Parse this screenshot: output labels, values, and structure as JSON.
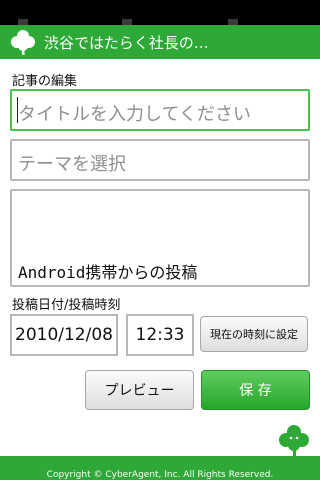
{
  "app": {
    "title": "渋谷ではたらく社長の…",
    "brand_color": "#2ea836"
  },
  "form": {
    "section_label": "記事の編集",
    "title_field": {
      "placeholder": "タイトルを入力してください",
      "value": ""
    },
    "theme_select": {
      "placeholder": "テーマを選択",
      "value": ""
    },
    "body_field": {
      "value": "Android携帯からの投稿"
    },
    "datetime_label": "投稿日付/投稿時刻",
    "date_value": "2010/12/08",
    "time_value": "12:33",
    "set_now_button": "現在の時刻に設定",
    "preview_button": "プレビュー",
    "save_button": "保 存"
  },
  "footer": {
    "copyright": "Copyright © CyberAgent, Inc. All Rights Reserved."
  },
  "icons": {
    "app_logo": "clover-icon",
    "corner_logo": "clover-icon"
  }
}
